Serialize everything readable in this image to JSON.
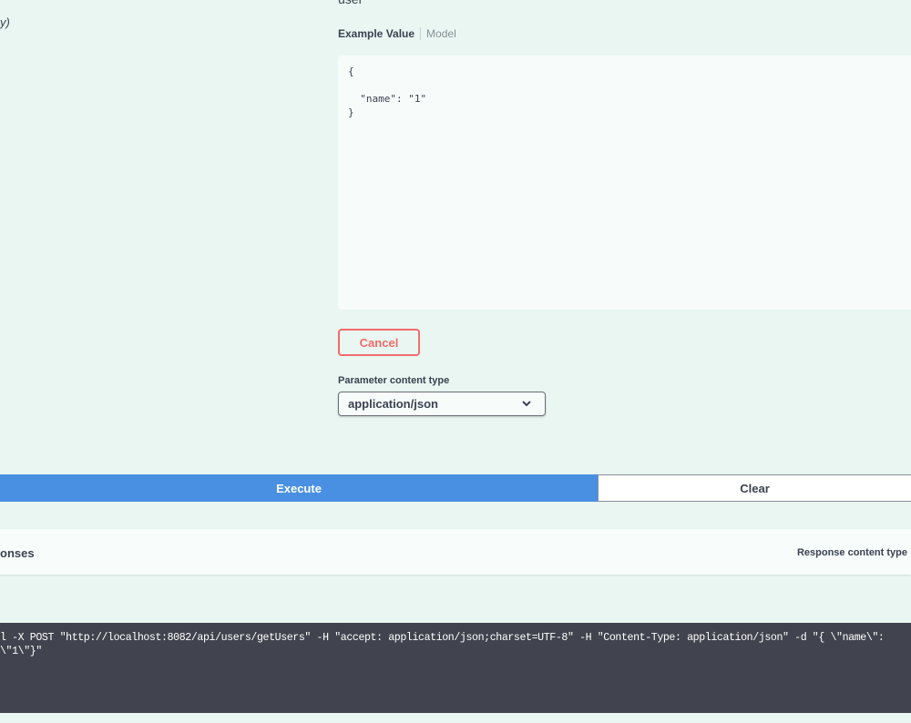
{
  "body_description_fragment": "user",
  "left_fragment": "y)",
  "example_tabs": {
    "active": "Example Value",
    "inactive": "Model"
  },
  "example_value": "{\n\n  \"name\": \"1\"\n}",
  "cancel_label": "Cancel",
  "parameter_content_type": {
    "label": "Parameter content type",
    "selected": "application/json"
  },
  "execute_label": "Execute",
  "clear_label": "Clear",
  "responses": {
    "title": "onses",
    "right_label": "Response content type"
  },
  "curl_command": "l -X POST \"http://localhost:8082/api/users/getUsers\" -H \"accept: application/json;charset=UTF-8\" -H \"Content-Type: application/json\" -d \"{ \\\"name\\\": \\\"1\\\"}\"",
  "colors": {
    "background": "#e9f6f1",
    "execute": "#4990e2",
    "cancel": "#f36b6b",
    "curl_bg": "#41444e"
  }
}
